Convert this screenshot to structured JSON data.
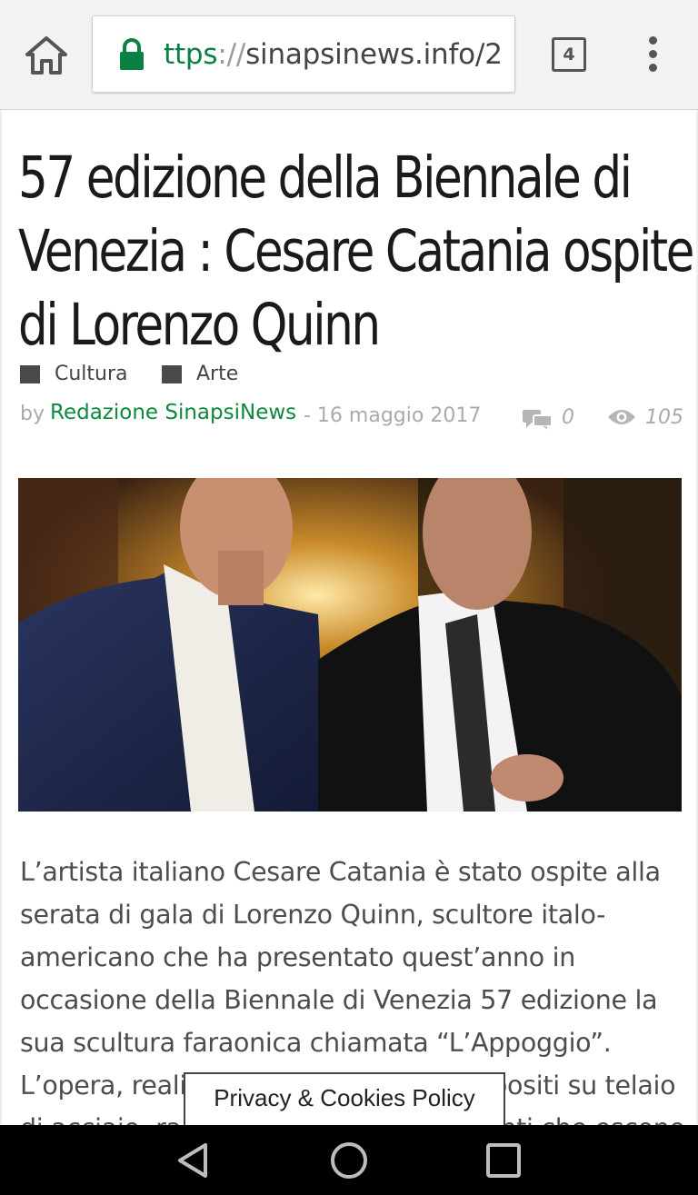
{
  "browser": {
    "url_scheme": "ttps",
    "url_sep": "://",
    "url_rest": "sinapsinews.info/2",
    "tab_count": "4",
    "icons": [
      "home-icon",
      "lock-icon",
      "tabs-icon",
      "overflow-menu-icon"
    ]
  },
  "article": {
    "title": "57 edizione della Biennale di Venezia : Cesare Catania ospite di Lorenzo Quinn",
    "categories": [
      "Cultura",
      "Arte"
    ],
    "by_label": "by",
    "author": "Redazione SinapsiNews",
    "date": "- 16 maggio 2017",
    "comments": "0",
    "views": "105",
    "body": "L’artista italiano Cesare Catania è stato ospite alla serata di gala di Lorenzo Quinn, scultore italo-americano che ha presentato quest’anno in occasione della Biennale di Venezia 57 edizione la sua scultura faraonica chiamata “L’Appoggio”. L’opera, realizzata con materiali compositi su telaio di acciaio, rappresenta due mani giganti che escono"
  },
  "privacy": {
    "label": "Privacy & Cookies Policy"
  },
  "colors": {
    "author_link": "#0e8a3e",
    "lock": "#0b8043",
    "nav_bar": "#000000"
  }
}
